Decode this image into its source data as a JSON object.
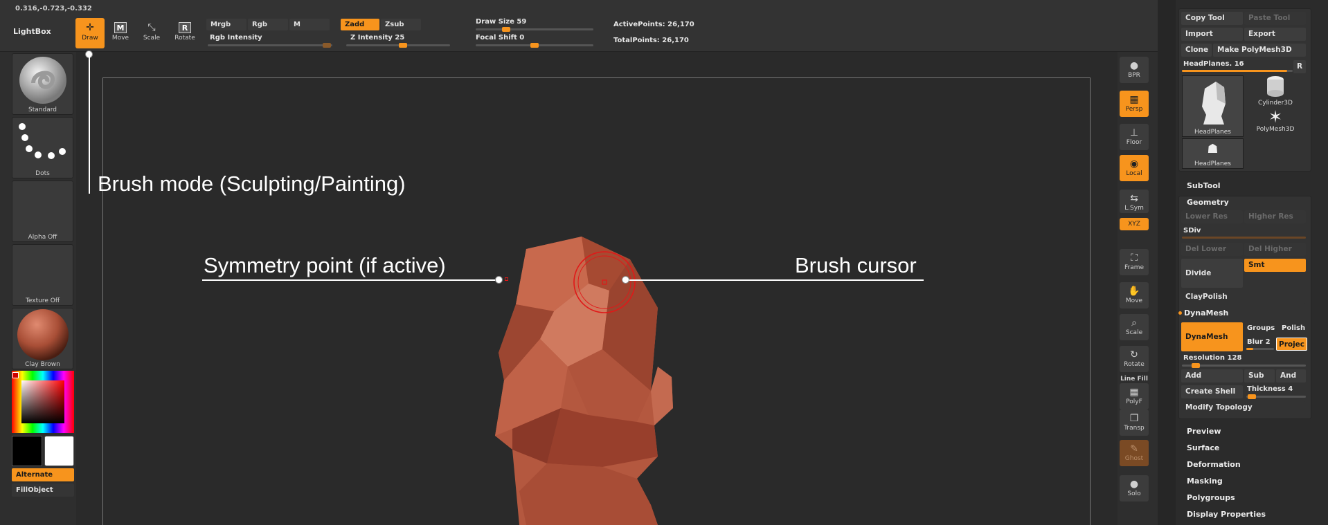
{
  "top": {
    "coordinates": "0.316,-0.723,-0.332",
    "lightbox": "LightBox",
    "tools": [
      {
        "label": "Draw",
        "icon": "draw-icon"
      },
      {
        "label": "Move",
        "icon": "move-icon",
        "glyph": "M"
      },
      {
        "label": "Scale",
        "icon": "scale-icon"
      },
      {
        "label": "Rotate",
        "icon": "rotate-icon",
        "glyph": "R"
      }
    ],
    "mrgb": "Mrgb",
    "rgb": "Rgb",
    "m": "M",
    "rgb_intensity": "Rgb Intensity",
    "zadd": "Zadd",
    "zsub": "Zsub",
    "z_intensity": "Z Intensity 25",
    "z_intensity_value": 25,
    "draw_size": "Draw Size 59",
    "draw_size_value": 59,
    "focal_shift": "Focal Shift 0",
    "focal_shift_value": 0,
    "active_points": "ActivePoints: 26,170",
    "total_points": "TotalPoints: 26,170"
  },
  "left": {
    "brush": "Standard",
    "stroke": "Dots",
    "alpha": "Alpha Off",
    "texture": "Texture Off",
    "material": "Clay Brown",
    "alternate": "Alternate",
    "fillobject": "FillObject"
  },
  "callouts": {
    "brush_mode": "Brush mode (Sculpting/Painting)",
    "symmetry": "Symmetry point (if active)",
    "cursor": "Brush cursor"
  },
  "right_shelf": [
    {
      "label": "BPR",
      "icon": "bpr-icon"
    },
    {
      "label": "Persp",
      "icon": "perspective-icon",
      "state": "on"
    },
    {
      "label": "Floor",
      "icon": "floor-icon"
    },
    {
      "label": "Local",
      "icon": "local-icon",
      "state": "on"
    },
    {
      "label": "L.Sym",
      "icon": "local-symmetry-icon"
    },
    {
      "label": "XYZ",
      "icon": "xyz-icon",
      "state": "on"
    },
    {
      "label": "Frame",
      "icon": "frame-icon"
    },
    {
      "label": "Move",
      "icon": "move-view-icon"
    },
    {
      "label": "Scale",
      "icon": "scale-view-icon"
    },
    {
      "label": "Rotate",
      "icon": "rotate-view-icon"
    },
    {
      "label": "Line Fill",
      "icon": "line-fill-icon"
    },
    {
      "label": "PolyF",
      "icon": "polyframe-icon"
    },
    {
      "label": "Transp",
      "icon": "transparency-icon"
    },
    {
      "label": "Ghost",
      "icon": "ghost-icon",
      "state": "dim"
    },
    {
      "label": "Solo",
      "icon": "solo-icon"
    }
  ],
  "palette": {
    "copy_tool": "Copy Tool",
    "paste_tool": "Paste Tool",
    "import": "Import",
    "export": "Export",
    "clone": "Clone",
    "make_polymesh": "Make PolyMesh3D",
    "headplanes_slider": "HeadPlanes. 16",
    "r": "R",
    "tool_headplanes": "HeadPlanes",
    "tool_cylinder": "Cylinder3D",
    "tool_polymesh": "PolyMesh3D",
    "tool_headplanes_small": "HeadPlanes",
    "subtool": "SubTool",
    "geometry": "Geometry",
    "lower_res": "Lower Res",
    "higher_res": "Higher Res",
    "sdiv": "SDiv",
    "del_lower": "Del Lower",
    "del_higher": "Del Higher",
    "divide": "Divide",
    "smt": "Smt",
    "claypolish": "ClayPolish",
    "dynamesh_section": "DynaMesh",
    "dynamesh_button": "DynaMesh",
    "groups": "Groups",
    "polish": "Polish",
    "blur": "Blur 2",
    "project": "Projec",
    "resolution": "Resolution 128",
    "add": "Add",
    "sub": "Sub",
    "and": "And",
    "create_shell": "Create Shell",
    "thickness": "Thickness 4",
    "modify_topology": "Modify Topology",
    "preview": "Preview",
    "surface": "Surface",
    "deformation": "Deformation",
    "masking": "Masking",
    "polygroups": "Polygroups",
    "display_properties": "Display Properties"
  },
  "colors": {
    "accent": "#f7941d",
    "clay": "#b4583f"
  }
}
